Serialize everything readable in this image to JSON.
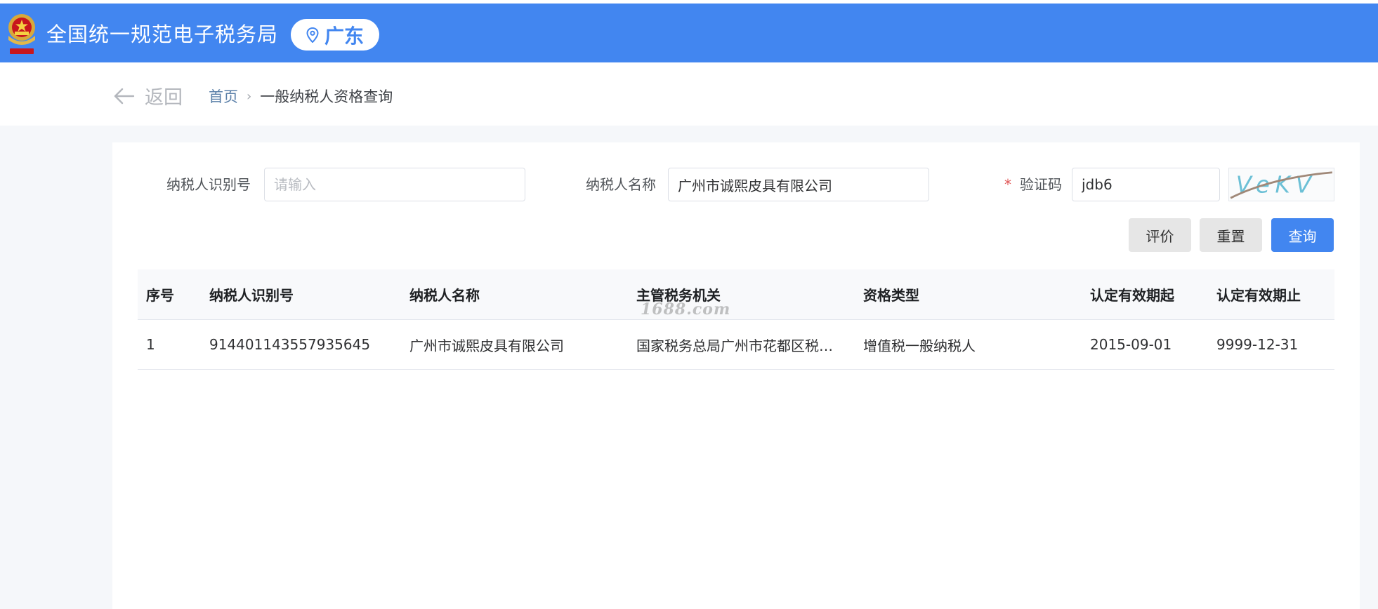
{
  "header": {
    "site_title": "全国统一规范电子税务局",
    "region": "广东",
    "emblem_icon": "national-emblem-icon",
    "location_icon": "location-pin-icon",
    "brand_color": "#4286f0"
  },
  "nav": {
    "back_label": "返回",
    "breadcrumb": {
      "home": "首页",
      "current": "一般纳税人资格查询"
    }
  },
  "form": {
    "taxpayer_id": {
      "label": "纳税人识别号",
      "value": "",
      "placeholder": "请输入"
    },
    "taxpayer_name": {
      "label": "纳税人名称",
      "value": "广州市诚熙皮具有限公司"
    },
    "captcha": {
      "required_mark": "*",
      "label": "验证码",
      "value": "jdb6",
      "image_text": "VeKV"
    }
  },
  "buttons": {
    "evaluate": "评价",
    "reset": "重置",
    "query": "查询"
  },
  "table": {
    "headers": [
      "序号",
      "纳税人识别号",
      "纳税人名称",
      "主管税务机关",
      "资格类型",
      "认定有效期起",
      "认定有效期止"
    ],
    "rows": [
      [
        "1",
        "914401143557935645",
        "广州市诚熙皮具有限公司",
        "国家税务总局广州市花都区税务局",
        "增值税一般纳税人",
        "2015-09-01",
        "9999-12-31"
      ]
    ]
  },
  "watermark": "1688.com"
}
